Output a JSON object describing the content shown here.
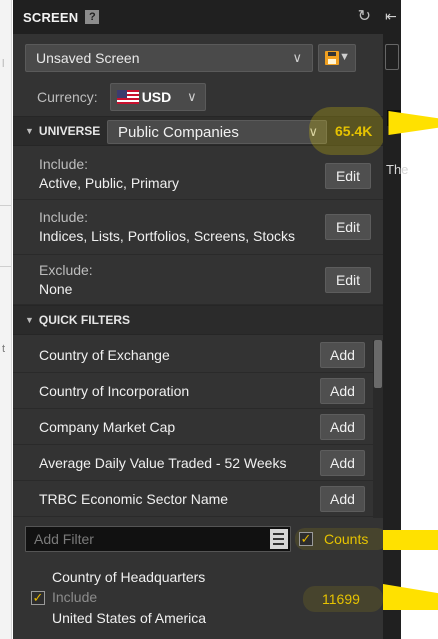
{
  "panel": {
    "title": "SCREEN",
    "help_glyph": "?",
    "refresh_glyph": "C"
  },
  "screen_select": {
    "value": "Unsaved Screen"
  },
  "currency": {
    "label": "Currency:",
    "code": "USD"
  },
  "universe": {
    "label": "UNIVERSE",
    "selected": "Public Companies",
    "count": "65.4K",
    "criteria": [
      {
        "key": "Include:",
        "value": "Active, Public, Primary",
        "button": "Edit"
      },
      {
        "key": "Include:",
        "value": "Indices, Lists, Portfolios, Screens, Stocks",
        "button": "Edit"
      },
      {
        "key": "Exclude:",
        "value": "None",
        "button": "Edit"
      }
    ]
  },
  "quick_filters": {
    "label": "QUICK FILTERS",
    "items": [
      {
        "name": "Country of Exchange",
        "button": "Add"
      },
      {
        "name": "Country of Incorporation",
        "button": "Add"
      },
      {
        "name": "Company Market Cap",
        "button": "Add"
      },
      {
        "name": "Average Daily Value Traded - 52 Weeks",
        "button": "Add"
      },
      {
        "name": "TRBC Economic Sector Name",
        "button": "Add"
      }
    ]
  },
  "add_filter": {
    "placeholder": "Add Filter",
    "counts_label": "Counts",
    "counts_checked": true
  },
  "hq_filter": {
    "name": "Country of Headquarters",
    "mode": "Include",
    "value": "United States of America",
    "count": "11699",
    "checked": true
  },
  "right_panel": {
    "text_fragment": "The"
  },
  "colors": {
    "panel_bg": "#333333",
    "titlebar_bg": "#202020",
    "accent_yellow": "#e6c300",
    "highlight": "#ffe100"
  }
}
